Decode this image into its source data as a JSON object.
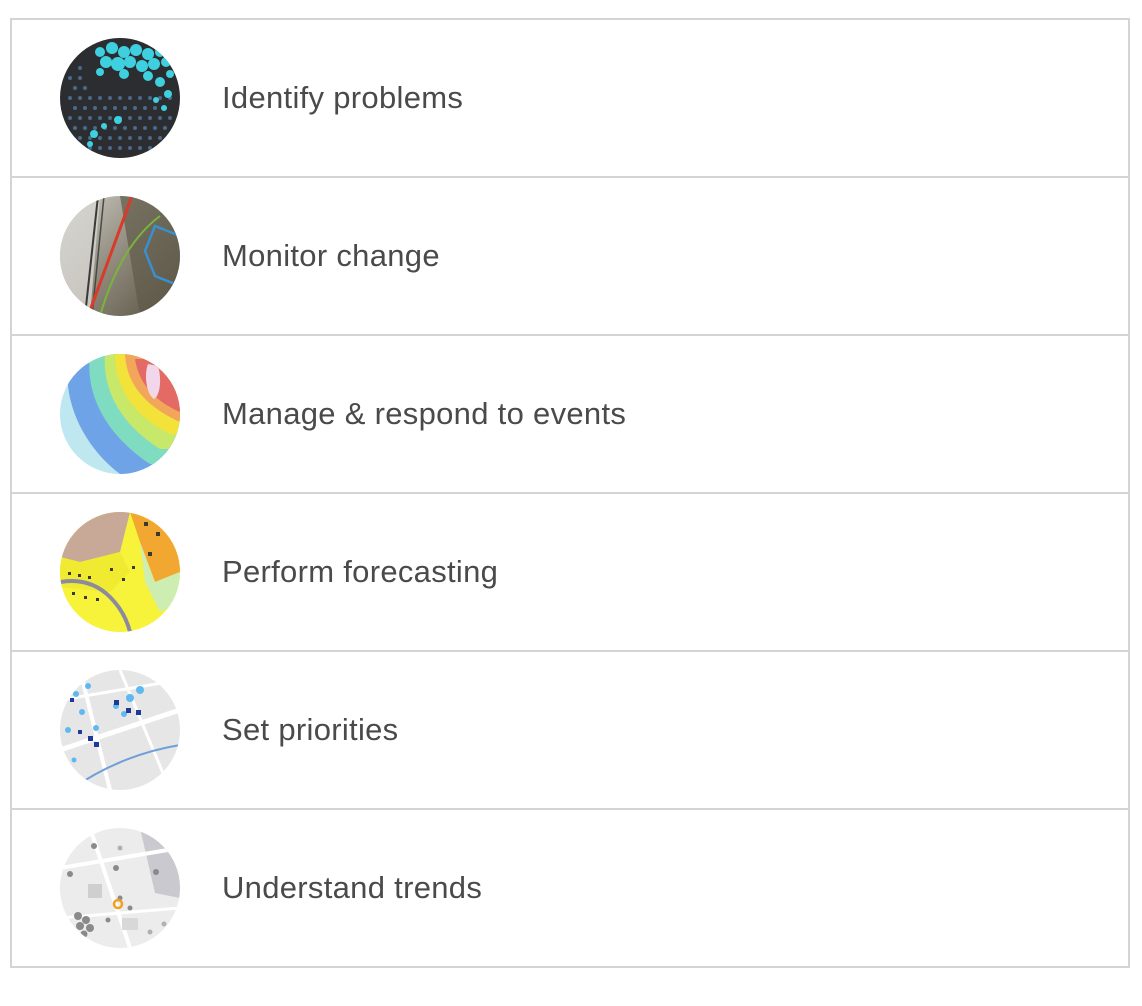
{
  "items": [
    {
      "label": "Identify problems",
      "icon": "hexbin-map-icon"
    },
    {
      "label": "Monitor change",
      "icon": "imagery-change-map-icon"
    },
    {
      "label": "Manage & respond to events",
      "icon": "heat-zone-map-icon"
    },
    {
      "label": "Perform forecasting",
      "icon": "land-use-map-icon"
    },
    {
      "label": "Set priorities",
      "icon": "point-cluster-map-icon"
    },
    {
      "label": "Understand trends",
      "icon": "trend-points-map-icon"
    }
  ]
}
